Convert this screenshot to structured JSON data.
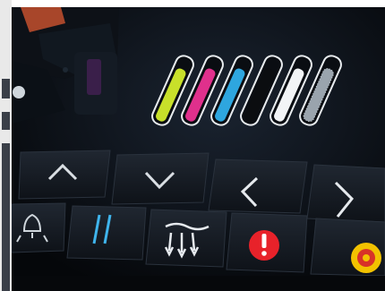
{
  "ink_cartridges": [
    {
      "color": "yellow",
      "fill": "#c8e02a",
      "level": 0.85
    },
    {
      "color": "magenta",
      "fill": "#e0308c",
      "level": 0.85
    },
    {
      "color": "cyan",
      "fill": "#2ea6df",
      "level": 0.85
    },
    {
      "color": "black",
      "fill": "#0b0d10",
      "level": 0.85
    },
    {
      "color": "white",
      "fill": "#f2f4f6",
      "level": 0.85
    },
    {
      "color": "gray",
      "fill": "#9aa4ad",
      "level": 0.85
    }
  ],
  "nav_buttons": [
    {
      "name": "up-button",
      "icon": "chevron-up-icon"
    },
    {
      "name": "down-button",
      "icon": "chevron-down-icon"
    },
    {
      "name": "left-button",
      "icon": "chevron-left-icon"
    },
    {
      "name": "right-button",
      "icon": "chevron-right-icon"
    }
  ],
  "function_buttons": [
    {
      "name": "light-button",
      "icon": "lamp-icon"
    },
    {
      "name": "pause-button",
      "icon": "pause-icon"
    },
    {
      "name": "heater-button",
      "icon": "heater-icon"
    },
    {
      "name": "alert-button",
      "icon": "exclamation-icon",
      "accent": "#e8222a"
    },
    {
      "name": "emergency-button",
      "icon": "emergency-stop-icon",
      "accent": "#f2c200"
    }
  ]
}
